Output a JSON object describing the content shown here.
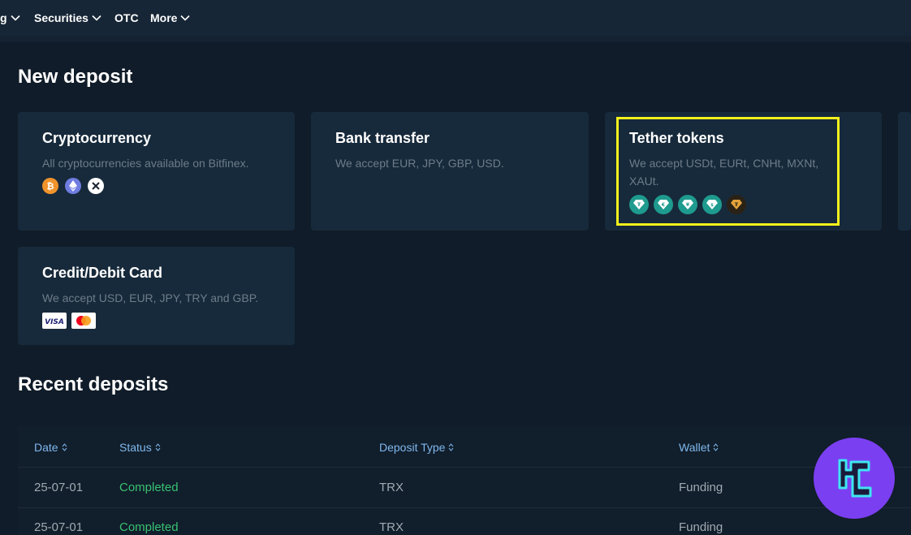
{
  "nav": {
    "items": [
      {
        "label": "g",
        "has_chevron": true
      },
      {
        "label": "Securities",
        "has_chevron": true
      },
      {
        "label": "OTC",
        "has_chevron": false
      },
      {
        "label": "More",
        "has_chevron": true
      }
    ]
  },
  "new_deposit": {
    "heading": "New deposit",
    "cards": [
      {
        "title": "Cryptocurrency",
        "description": "All cryptocurrencies available on Bitfinex.",
        "icons": [
          "bitcoin-icon",
          "ethereum-icon",
          "xrp-icon"
        ]
      },
      {
        "title": "Bank transfer",
        "description": "We accept EUR, JPY, GBP, USD."
      },
      {
        "title": "Tether tokens",
        "description": "We accept USDt, EURt, CNHt, MXNt, XAUt.",
        "icons": [
          "usdt-icon",
          "eurt-icon",
          "cnht-icon",
          "mxnt-icon",
          "xaut-icon"
        ],
        "highlighted": true
      },
      {
        "title": "Credit/Debit Card",
        "description": "We accept USD, EUR, JPY, TRY and GBP.",
        "icons": [
          "visa-icon",
          "mastercard-icon"
        ]
      }
    ]
  },
  "recent_deposits": {
    "heading": "Recent deposits",
    "columns": [
      "Date",
      "Status",
      "Deposit Type",
      "Wallet"
    ],
    "rows": [
      {
        "date": "25-07-01",
        "status": "Completed",
        "deposit_type": "TRX",
        "wallet": "Funding"
      },
      {
        "date": "25-07-01",
        "status": "Completed",
        "deposit_type": "TRX",
        "wallet": "Funding"
      }
    ]
  },
  "colors": {
    "background": "#101c29",
    "card": "#172a3b",
    "highlight": "#f6f21c",
    "link_header": "#7fb8ee",
    "status_completed": "#38c172",
    "tether": "#1e9b8e",
    "logo": "#7b3ff2"
  }
}
